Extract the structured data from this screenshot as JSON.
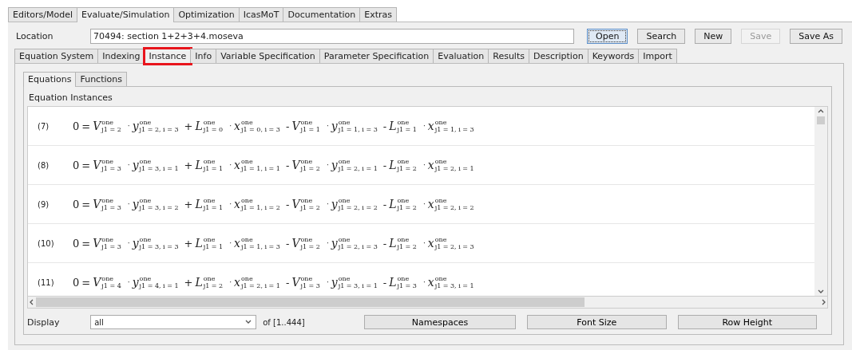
{
  "main_tabs": [
    {
      "label": "Editors/Model",
      "selected": false
    },
    {
      "label": "Evaluate/Simulation",
      "selected": true
    },
    {
      "label": "Optimization",
      "selected": false
    },
    {
      "label": "IcasMoT",
      "selected": false
    },
    {
      "label": "Documentation",
      "selected": false
    },
    {
      "label": "Extras",
      "selected": false
    }
  ],
  "location": {
    "label": "Location",
    "value": "70494: section 1+2+3+4.moseva"
  },
  "buttons": [
    {
      "label": "Open",
      "disabled": false,
      "focused": true
    },
    {
      "label": "Search",
      "disabled": false,
      "focused": false
    },
    {
      "label": "New",
      "disabled": false,
      "focused": false
    },
    {
      "label": "Save",
      "disabled": true,
      "focused": false
    },
    {
      "label": "Save As",
      "disabled": false,
      "focused": false
    }
  ],
  "section_tabs": [
    {
      "label": "Equation System",
      "selected": false,
      "highlighted": false
    },
    {
      "label": "Indexing",
      "selected": false,
      "highlighted": false
    },
    {
      "label": "Instance",
      "selected": true,
      "highlighted": true
    },
    {
      "label": "Info",
      "selected": false,
      "highlighted": false
    },
    {
      "label": "Variable Specification",
      "selected": false,
      "highlighted": false
    },
    {
      "label": "Parameter Specification",
      "selected": false,
      "highlighted": false
    },
    {
      "label": "Evaluation",
      "selected": false,
      "highlighted": false
    },
    {
      "label": "Results",
      "selected": false,
      "highlighted": false
    },
    {
      "label": "Description",
      "selected": false,
      "highlighted": false
    },
    {
      "label": "Keywords",
      "selected": false,
      "highlighted": false
    },
    {
      "label": "Import",
      "selected": false,
      "highlighted": false
    }
  ],
  "sub_tabs": [
    {
      "label": "Equations",
      "selected": true
    },
    {
      "label": "Functions",
      "selected": false
    }
  ],
  "instances": {
    "title": "Equation Instances",
    "rows": [
      {
        "number": "(7)",
        "lhs": "0",
        "terms": [
          {
            "op": "=",
            "factors": [
              {
                "symbol": "V",
                "sup": "one",
                "sub": "j1 = 2"
              },
              {
                "op": "·",
                "symbol": "y",
                "sup": "one",
                "sub": "j1 = 2, i = 3"
              }
            ]
          },
          {
            "op": "+",
            "factors": [
              {
                "symbol": "L",
                "sup": "one",
                "sub": "j1 = 0"
              },
              {
                "op": "·",
                "symbol": "x",
                "sup": "one",
                "sub": "j1 = 0, i = 3"
              }
            ]
          },
          {
            "op": "-",
            "factors": [
              {
                "symbol": "V",
                "sup": "one",
                "sub": "j1 = 1"
              },
              {
                "op": "·",
                "symbol": "y",
                "sup": "one",
                "sub": "j1 = 1, i = 3"
              }
            ]
          },
          {
            "op": "-",
            "factors": [
              {
                "symbol": "L",
                "sup": "one",
                "sub": "j1 = 1"
              },
              {
                "op": "·",
                "symbol": "x",
                "sup": "one",
                "sub": "j1 = 1, i = 3"
              }
            ]
          }
        ]
      },
      {
        "number": "(8)",
        "lhs": "0",
        "terms": [
          {
            "op": "=",
            "factors": [
              {
                "symbol": "V",
                "sup": "one",
                "sub": "j1 = 3"
              },
              {
                "op": "·",
                "symbol": "y",
                "sup": "one",
                "sub": "j1 = 3, i = 1"
              }
            ]
          },
          {
            "op": "+",
            "factors": [
              {
                "symbol": "L",
                "sup": "one",
                "sub": "j1 = 1"
              },
              {
                "op": "·",
                "symbol": "x",
                "sup": "one",
                "sub": "j1 = 1, i = 1"
              }
            ]
          },
          {
            "op": "-",
            "factors": [
              {
                "symbol": "V",
                "sup": "one",
                "sub": "j1 = 2"
              },
              {
                "op": "·",
                "symbol": "y",
                "sup": "one",
                "sub": "j1 = 2, i = 1"
              }
            ]
          },
          {
            "op": "-",
            "factors": [
              {
                "symbol": "L",
                "sup": "one",
                "sub": "j1 = 2"
              },
              {
                "op": "·",
                "symbol": "x",
                "sup": "one",
                "sub": "j1 = 2, i = 1"
              }
            ]
          }
        ]
      },
      {
        "number": "(9)",
        "lhs": "0",
        "terms": [
          {
            "op": "=",
            "factors": [
              {
                "symbol": "V",
                "sup": "one",
                "sub": "j1 = 3"
              },
              {
                "op": "·",
                "symbol": "y",
                "sup": "one",
                "sub": "j1 = 3, i = 2"
              }
            ]
          },
          {
            "op": "+",
            "factors": [
              {
                "symbol": "L",
                "sup": "one",
                "sub": "j1 = 1"
              },
              {
                "op": "·",
                "symbol": "x",
                "sup": "one",
                "sub": "j1 = 1, i = 2"
              }
            ]
          },
          {
            "op": "-",
            "factors": [
              {
                "symbol": "V",
                "sup": "one",
                "sub": "j1 = 2"
              },
              {
                "op": "·",
                "symbol": "y",
                "sup": "one",
                "sub": "j1 = 2, i = 2"
              }
            ]
          },
          {
            "op": "-",
            "factors": [
              {
                "symbol": "L",
                "sup": "one",
                "sub": "j1 = 2"
              },
              {
                "op": "·",
                "symbol": "x",
                "sup": "one",
                "sub": "j1 = 2, i = 2"
              }
            ]
          }
        ]
      },
      {
        "number": "(10)",
        "lhs": "0",
        "terms": [
          {
            "op": "=",
            "factors": [
              {
                "symbol": "V",
                "sup": "one",
                "sub": "j1 = 3"
              },
              {
                "op": "·",
                "symbol": "y",
                "sup": "one",
                "sub": "j1 = 3, i = 3"
              }
            ]
          },
          {
            "op": "+",
            "factors": [
              {
                "symbol": "L",
                "sup": "one",
                "sub": "j1 = 1"
              },
              {
                "op": "·",
                "symbol": "x",
                "sup": "one",
                "sub": "j1 = 1, i = 3"
              }
            ]
          },
          {
            "op": "-",
            "factors": [
              {
                "symbol": "V",
                "sup": "one",
                "sub": "j1 = 2"
              },
              {
                "op": "·",
                "symbol": "y",
                "sup": "one",
                "sub": "j1 = 2, i = 3"
              }
            ]
          },
          {
            "op": "-",
            "factors": [
              {
                "symbol": "L",
                "sup": "one",
                "sub": "j1 = 2"
              },
              {
                "op": "·",
                "symbol": "x",
                "sup": "one",
                "sub": "j1 = 2, i = 3"
              }
            ]
          }
        ]
      },
      {
        "number": "(11)",
        "lhs": "0",
        "terms": [
          {
            "op": "=",
            "factors": [
              {
                "symbol": "V",
                "sup": "one",
                "sub": "j1 = 4"
              },
              {
                "op": "·",
                "symbol": "y",
                "sup": "one",
                "sub": "j1 = 4, i = 1"
              }
            ]
          },
          {
            "op": "+",
            "factors": [
              {
                "symbol": "L",
                "sup": "one",
                "sub": "j1 = 2"
              },
              {
                "op": "·",
                "symbol": "x",
                "sup": "one",
                "sub": "j1 = 2, i = 1"
              }
            ]
          },
          {
            "op": "-",
            "factors": [
              {
                "symbol": "V",
                "sup": "one",
                "sub": "j1 = 3"
              },
              {
                "op": "·",
                "symbol": "y",
                "sup": "one",
                "sub": "j1 = 3, i = 1"
              }
            ]
          },
          {
            "op": "-",
            "factors": [
              {
                "symbol": "L",
                "sup": "one",
                "sub": "j1 = 3"
              },
              {
                "op": "·",
                "symbol": "x",
                "sup": "one",
                "sub": "j1 = 3, i = 1"
              }
            ]
          }
        ]
      }
    ]
  },
  "footer": {
    "display_label": "Display",
    "display_value": "all",
    "range": "of [1..444]",
    "buttons": [
      "Namespaces",
      "Font Size",
      "Row Height"
    ]
  }
}
